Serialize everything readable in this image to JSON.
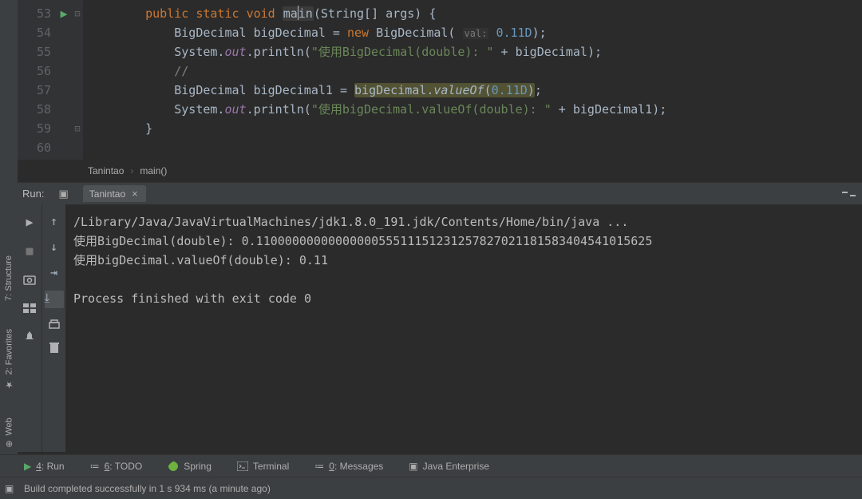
{
  "editor": {
    "lines": [
      "53",
      "54",
      "55",
      "56",
      "57",
      "58",
      "59",
      "60"
    ],
    "code": {
      "l53": {
        "indent": "    ",
        "k1": "public",
        "k2": "static",
        "k3": "void",
        "name": "main",
        "params": "(String[] args) {"
      },
      "l54": {
        "indent": "        ",
        "type": "BigDecimal",
        "var": "bigDecimal",
        "eq": " = ",
        "new": "new",
        "ctor": "BigDecimal(",
        "hint": "val:",
        "num": "0.11D",
        "end": ");"
      },
      "l55": {
        "indent": "        ",
        "sys": "System.",
        "out": "out",
        "prt": ".println(",
        "str": "\"使用BigDecimal(double): \"",
        "plus": " + ",
        "bd": "bigDecimal",
        "end": ");"
      },
      "l56": {
        "indent": "        ",
        "cmt": "//"
      },
      "l57": {
        "indent": "        ",
        "type": "BigDecimal",
        "var": "bigDecimal1",
        "eq": " = ",
        "bd": "bigDecimal.",
        "vof": "valueOf",
        "p1": "(",
        "num": "0.11D",
        "p2": ")",
        "end": ";"
      },
      "l58": {
        "indent": "        ",
        "sys": "System.",
        "out": "out",
        "prt": ".println(",
        "str": "\"使用bigDecimal.valueOf(double): \"",
        "plus": " + ",
        "bd": "bigDecimal1",
        "end": ");"
      },
      "l59": {
        "indent": "    ",
        "brace": "}"
      }
    }
  },
  "breadcrumb": {
    "class": "Tanintao",
    "method": "main()"
  },
  "run": {
    "label": "Run:",
    "tab": "Tanintao",
    "console": "/Library/Java/JavaVirtualMachines/jdk1.8.0_191.jdk/Contents/Home/bin/java ...\n使用BigDecimal(double): 0.1100000000000000055511151231257827021181583404541015625\n使用bigDecimal.valueOf(double): 0.11\n\nProcess finished with exit code 0"
  },
  "left_tabs": {
    "structure": "7: Structure",
    "favorites": "2: Favorites",
    "web": "Web"
  },
  "bottom": {
    "run": "4: Run",
    "todo": "6: TODO",
    "spring": "Spring",
    "terminal": "Terminal",
    "messages": "0: Messages",
    "enterprise": "Java Enterprise"
  },
  "status": "Build completed successfully in 1 s 934 ms (a minute ago)"
}
